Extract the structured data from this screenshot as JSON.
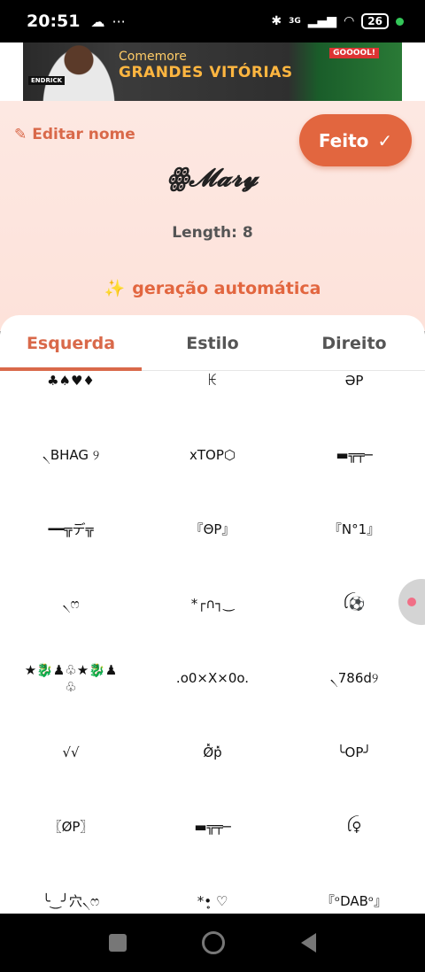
{
  "status": {
    "time": "20:51",
    "battery": "26",
    "network": "3G"
  },
  "ad": {
    "player_tag": "ENDRICK",
    "line1": "Comemore",
    "line2": "GRANDES VITÓRIAS",
    "goal": "GOOOOL!"
  },
  "header": {
    "edit_label": "Editar nome",
    "done_label": "Feito"
  },
  "preview": {
    "name": "ꙮ𝓜𝓪𝓻𝔂",
    "length": "Length: 8"
  },
  "autogen_label": "geração automática",
  "tabs": [
    {
      "label": "Esquerda",
      "active": true
    },
    {
      "label": "Estilo",
      "active": false
    },
    {
      "label": "Direito",
      "active": false
    }
  ],
  "symbols": [
    "♣♠♥♦",
    "ꀘ",
    "ƏP",
    "৲BHAG ୨",
    "xTOP⬡",
    "▬╦╤─",
    "━━╦デ╦",
    "『ΘΡ』",
    "『N°1』",
    "৲ෆ",
    "*┌∩┐‿",
    "ꪶ⚽",
    "★🐉♟♧★🐉♟\n♧",
    ".o0×X×0o.",
    "৲786d୨",
    "√√",
    "Ø̽p̽",
    "╰OP╯",
    "〖ØP〗",
    "▬╦╤─",
    "ꪶ♀",
    "╰‿╯穴৲ෆ",
    "*•̥ ♡",
    "『ᵒDABᵒ』"
  ]
}
